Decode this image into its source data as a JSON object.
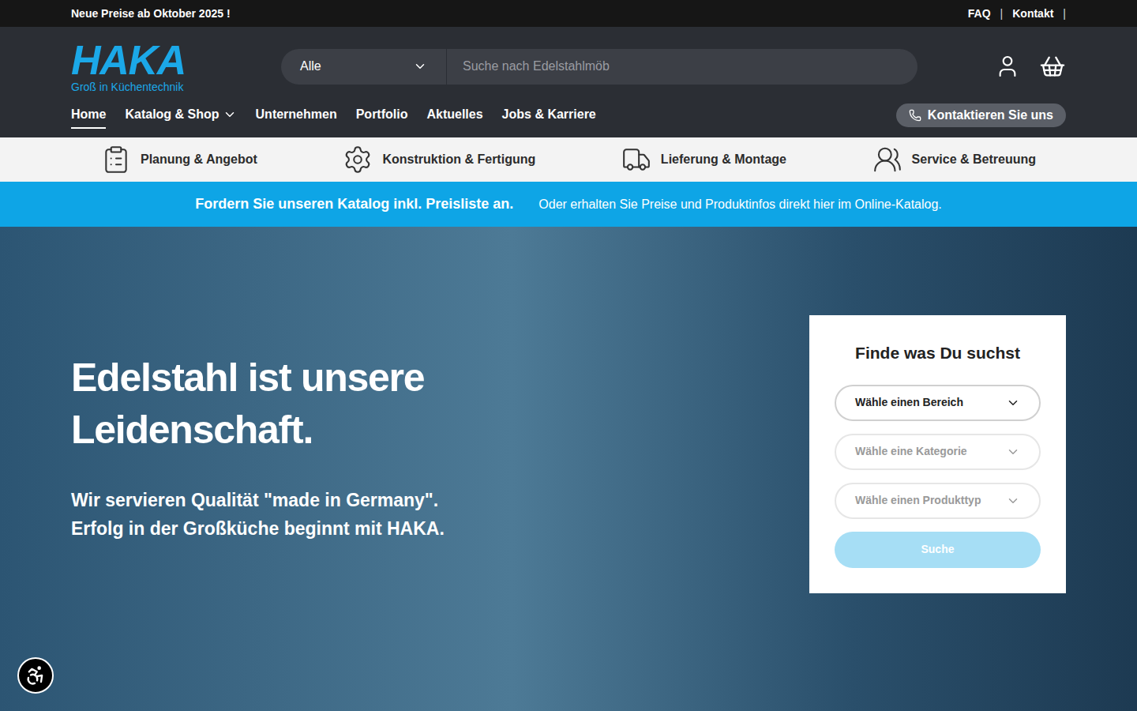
{
  "topbar": {
    "notice": "Neue Preise ab Oktober 2025 !",
    "links": [
      "FAQ",
      "Kontakt"
    ],
    "separator": "|"
  },
  "header": {
    "logo": {
      "name": "HAKA",
      "tagline": "Groß in Küchentechnik"
    },
    "search": {
      "category": "Alle",
      "placeholder": "Suche nach Edelstahlmöb"
    }
  },
  "nav": {
    "items": [
      {
        "label": "Home",
        "selected": true,
        "has_menu": false
      },
      {
        "label": "Katalog & Shop",
        "selected": false,
        "has_menu": true
      },
      {
        "label": "Unternehmen",
        "selected": false,
        "has_menu": false
      },
      {
        "label": "Portfolio",
        "selected": false,
        "has_menu": false
      },
      {
        "label": "Aktuelles",
        "selected": false,
        "has_menu": false
      },
      {
        "label": "Jobs & Karriere",
        "selected": false,
        "has_menu": false
      }
    ],
    "contact_button": "Kontaktieren Sie uns"
  },
  "services": [
    "Planung & Angebot",
    "Konstruktion & Fertigung",
    "Lieferung & Montage",
    "Service & Betreuung"
  ],
  "banner": {
    "bold": "Fordern Sie unseren Katalog inkl. Preisliste an.",
    "text": "Oder erhalten Sie Preise und Produktinfos direkt hier im Online-Katalog."
  },
  "hero": {
    "title": "Edelstahl ist unsere Leidenschaft.",
    "subtitle_lines": [
      "Wir servieren Qualität \"made in Germany\".",
      "Erfolg in der Großküche beginnt mit HAKA."
    ]
  },
  "finder": {
    "title": "Finde was Du suchst",
    "selects": [
      {
        "placeholder": "Wähle einen Bereich",
        "disabled": false
      },
      {
        "placeholder": "Wähle eine Kategorie",
        "disabled": true
      },
      {
        "placeholder": "Wähle einen Produkttyp",
        "disabled": true
      }
    ],
    "button": {
      "label": "Suche",
      "disabled": true
    }
  }
}
